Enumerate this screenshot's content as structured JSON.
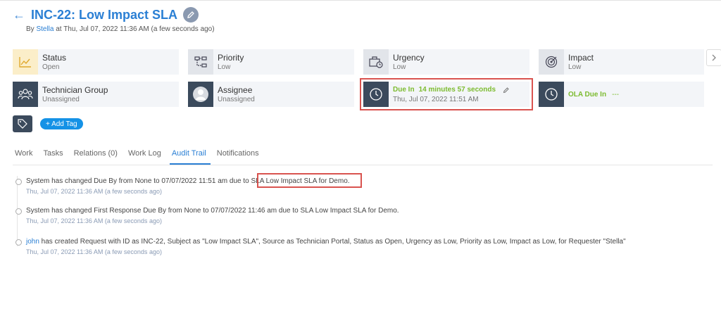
{
  "header": {
    "back_icon": "←",
    "title": "INC-22: Low Impact SLA",
    "by_prefix": "By",
    "by_name": "Stella",
    "by_suffix": "at Thu, Jul 07, 2022 11:36 AM (a few seconds ago)"
  },
  "cards": {
    "status": {
      "label": "Status",
      "value": "Open"
    },
    "priority": {
      "label": "Priority",
      "value": "Low"
    },
    "urgency": {
      "label": "Urgency",
      "value": "Low"
    },
    "impact": {
      "label": "Impact",
      "value": "Low"
    },
    "technician_group": {
      "label": "Technician Group",
      "value": "Unassigned"
    },
    "assignee": {
      "label": "Assignee",
      "value": "Unassigned"
    },
    "due": {
      "label": "Due In",
      "countdown": "14 minutes 57 seconds",
      "date": "Thu, Jul 07, 2022 11:51 AM"
    },
    "ola": {
      "label": "OLA Due In",
      "value": "---"
    }
  },
  "tags": {
    "add_label": "+ Add Tag"
  },
  "tabs": [
    "Work",
    "Tasks",
    "Relations (0)",
    "Work Log",
    "Audit Trail",
    "Notifications"
  ],
  "audit": [
    {
      "text_before": "System has changed Due By from None to 07/07/2022 11:51 am due to ",
      "text_highlight": "SLA Low Impact SLA for Demo.",
      "time": "Thu, Jul 07, 2022 11:36 AM (a few seconds ago)"
    },
    {
      "text": "System has changed First Response Due By from None to 07/07/2022 11:46 am due to SLA Low Impact SLA for Demo.",
      "time": "Thu, Jul 07, 2022 11:36 AM (a few seconds ago)"
    },
    {
      "user": "john",
      "text": " has created Request with ID as INC-22, Subject as \"Low Impact SLA\", Source as Technician Portal, Status as Open, Urgency as Low, Priority as Low, Impact as Low, for Requester \"Stella\"",
      "time": "Thu, Jul 07, 2022 11:36 AM (a few seconds ago)"
    }
  ]
}
